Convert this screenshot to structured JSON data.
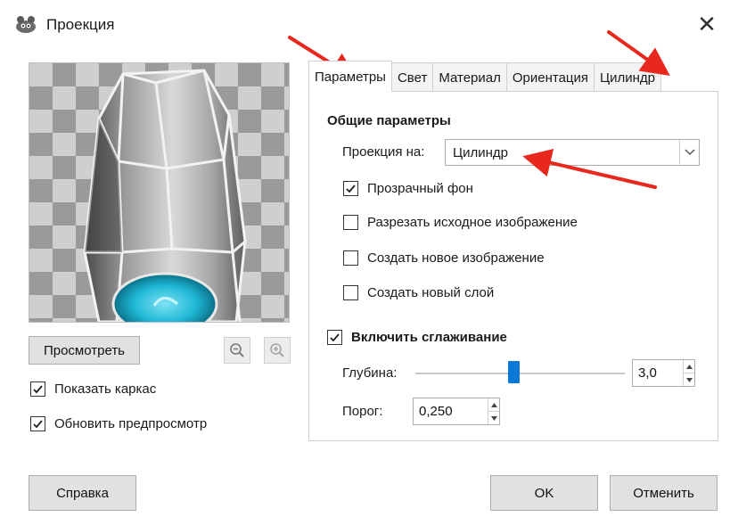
{
  "window": {
    "title": "Проекция",
    "close_glyph": "✕",
    "icon": "gimp-icon"
  },
  "preview": {
    "button_label": "Просмотреть",
    "zoom_out_icon": "zoom-out-icon",
    "zoom_in_icon": "zoom-in-icon",
    "show_wireframe": {
      "label": "Показать каркас",
      "checked": true
    },
    "auto_update": {
      "label": "Обновить предпросмотр",
      "checked": true
    }
  },
  "tabs": [
    {
      "label": "Параметры",
      "active": true
    },
    {
      "label": "Свет",
      "active": false
    },
    {
      "label": "Материал",
      "active": false
    },
    {
      "label": "Ориентация",
      "active": false
    },
    {
      "label": "Цилиндр",
      "active": false
    }
  ],
  "general": {
    "title": "Общие параметры",
    "map_to_label": "Проекция на:",
    "map_to_value": "Цилиндр",
    "transparent_bg": {
      "label": "Прозрачный фон",
      "checked": true
    },
    "tile_source": {
      "label": "Разрезать исходное изображение",
      "checked": false
    },
    "create_image": {
      "label": "Создать новое изображение",
      "checked": false
    },
    "create_layer": {
      "label": "Создать новый слой",
      "checked": false
    }
  },
  "antialias": {
    "label": "Включить сглаживание",
    "checked": true,
    "depth_label": "Глубина:",
    "depth_value": "3,0",
    "depth_slider_fraction": 0.47,
    "threshold_label": "Порог:",
    "threshold_value": "0,250"
  },
  "footer": {
    "help": "Справка",
    "ok": "OK",
    "cancel": "Отменить"
  },
  "colors": {
    "accent": "#0a78d7",
    "annotation_arrow": "#e8281e",
    "button_bg": "#e1e1e1",
    "cylinder_inner": "#1fb8d6"
  }
}
